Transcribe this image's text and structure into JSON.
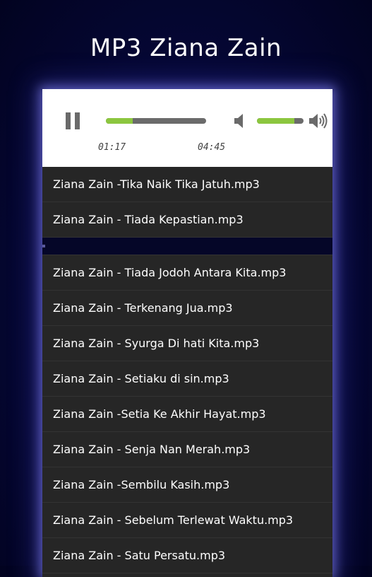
{
  "app": {
    "title": "MP3 Ziana Zain"
  },
  "player": {
    "current_time": "01:17",
    "duration": "04:45",
    "progress_fraction": 0.27,
    "volume_fraction": 0.8,
    "accent_color": "#8cc63f",
    "icons": {
      "play_state": "pause-icon",
      "volume_low": "speaker-low-icon",
      "volume_high": "speaker-high-icon"
    }
  },
  "playlist": [
    "Ziana Zain -Tika Naik Tika Jatuh.mp3",
    "Ziana Zain - Tiada Kepastian.mp3",
    "Ziana Zain - Tiada Jodoh Antara Kita.mp3",
    "Ziana Zain - Terkenang Jua.mp3",
    "Ziana Zain - Syurga Di hati Kita.mp3",
    "Ziana Zain - Setiaku di sin.mp3",
    "Ziana Zain -Setia Ke Akhir Hayat.mp3",
    "Ziana Zain - Senja Nan Merah.mp3",
    "Ziana Zain -Sembilu Kasih.mp3",
    "Ziana Zain - Sebelum Terlewat Waktu.mp3",
    "Ziana Zain - Satu Persatu.mp3"
  ]
}
